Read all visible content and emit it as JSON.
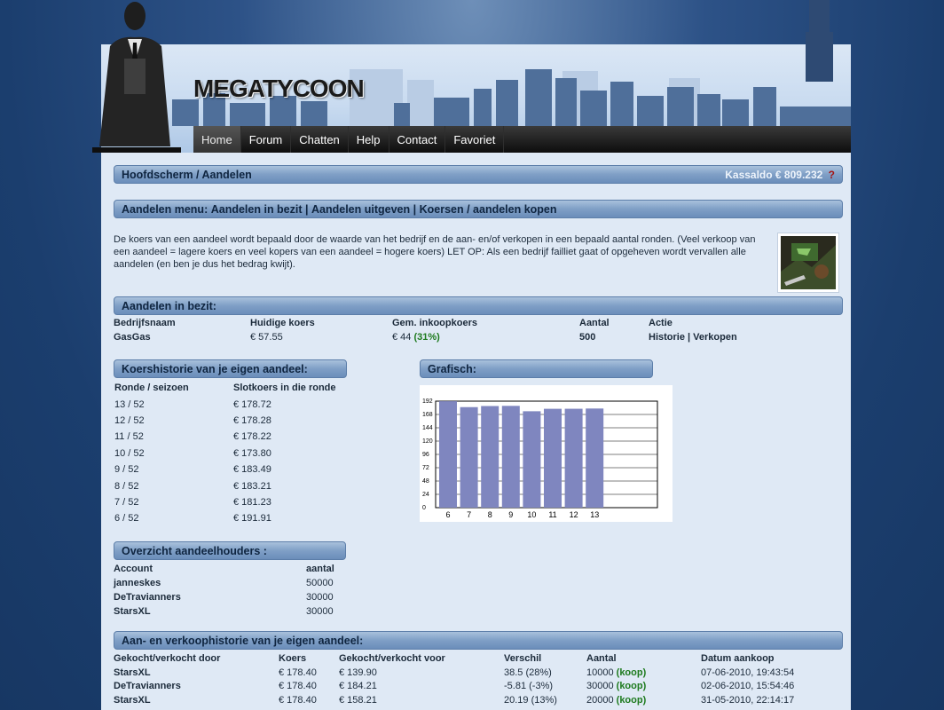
{
  "site": {
    "logo": "MEGATYCOON"
  },
  "nav": {
    "items": [
      "Home",
      "Forum",
      "Chatten",
      "Help",
      "Contact",
      "Favoriet"
    ]
  },
  "title_bar": {
    "breadcrumb": "Hoofdscherm / Aandelen",
    "balance": "Kassaldo € 809.232",
    "help": "?"
  },
  "menu_bar": {
    "label": "Aandelen menu:",
    "links": [
      "Aandelen in bezit",
      "Aandelen uitgeven",
      "Koersen / aandelen kopen"
    ],
    "separator": "|"
  },
  "intro_text": "De koers van een aandeel wordt bepaald door de waarde van het bedrijf en de aan- en/of verkopen in een bepaald aantal ronden. (Veel verkoop van een aandeel = lagere koers en veel kopers van een aandeel = hogere koers) LET OP: Als een bedrijf failliet gaat of opgeheven wordt vervallen alle aandelen (en ben je dus het bedrag kwijt).",
  "holdings": {
    "title": "Aandelen in bezit:",
    "headers": [
      "Bedrijfsnaam",
      "Huidige koers",
      "Gem. inkoopkoers",
      "Aantal",
      "Actie"
    ],
    "row": {
      "company": "GasGas",
      "current": "€ 57.55",
      "avg": "€ 44",
      "avg_pct": "(31%)",
      "amount": "500",
      "action_history": "Historie",
      "action_sep": "|",
      "action_sell": "Verkopen"
    }
  },
  "history": {
    "title": "Koershistorie van je eigen aandeel:",
    "headers": [
      "Ronde / seizoen",
      "Slotkoers in die ronde"
    ],
    "rows": [
      [
        "13 / 52",
        "€ 178.72"
      ],
      [
        "12 / 52",
        "€ 178.28"
      ],
      [
        "11 / 52",
        "€ 178.22"
      ],
      [
        "10 / 52",
        "€ 173.80"
      ],
      [
        "9 / 52",
        "€ 183.49"
      ],
      [
        "8 / 52",
        "€ 183.21"
      ],
      [
        "7 / 52",
        "€ 181.23"
      ],
      [
        "6 / 52",
        "€ 191.91"
      ]
    ]
  },
  "chart_section": {
    "title": "Grafisch:"
  },
  "chart_data": {
    "type": "bar",
    "title": "",
    "xlabel": "",
    "ylabel": "",
    "categories": [
      "6",
      "7",
      "8",
      "9",
      "10",
      "11",
      "12",
      "13"
    ],
    "values": [
      191.91,
      181.23,
      183.21,
      183.49,
      173.8,
      178.22,
      178.28,
      178.72
    ],
    "yticks": [
      0,
      24,
      48,
      72,
      96,
      120,
      144,
      168,
      192
    ],
    "ylim": [
      0,
      192
    ],
    "grid": true,
    "bar_color": "#7f86bf"
  },
  "shareholders": {
    "title": "Overzicht aandeelhouders :",
    "headers": [
      "Account",
      "aantal"
    ],
    "rows": [
      [
        "janneskes",
        "50000"
      ],
      [
        "DeTravianners",
        "30000"
      ],
      [
        "StarsXL",
        "30000"
      ]
    ]
  },
  "trades": {
    "title": "Aan- en verkoophistorie van je eigen aandeel:",
    "headers": [
      "Gekocht/verkocht door",
      "Koers",
      "Gekocht/verkocht voor",
      "Verschil",
      "Aantal",
      "Datum aankoop"
    ],
    "rows": [
      {
        "who": "StarsXL",
        "price": "€ 178.40",
        "for": "€ 139.90",
        "diff": "38.5 (28%)",
        "amount": "10000",
        "type": "(koop)",
        "date": "07-06-2010, 19:43:54"
      },
      {
        "who": "DeTravianners",
        "price": "€ 178.40",
        "for": "€ 184.21",
        "diff": "-5.81 (-3%)",
        "amount": "30000",
        "type": "(koop)",
        "date": "02-06-2010, 15:54:46"
      },
      {
        "who": "StarsXL",
        "price": "€ 178.40",
        "for": "€ 158.21",
        "diff": "20.19 (13%)",
        "amount": "20000",
        "type": "(koop)",
        "date": "31-05-2010, 22:14:17"
      }
    ]
  },
  "colors": {
    "accent_green": "#1d7a1d",
    "bar": "#7f86bf",
    "bg": "#1b3e6e"
  }
}
